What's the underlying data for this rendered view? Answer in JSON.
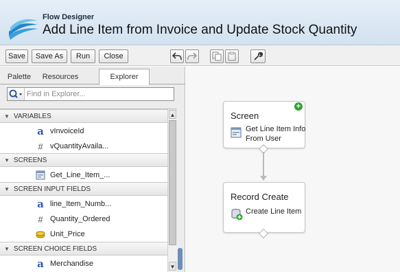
{
  "header": {
    "app_name": "Flow Designer",
    "flow_title": "Add Line Item from Invoice and Update Stock Quantity"
  },
  "toolbar": {
    "save": "Save",
    "save_as": "Save As",
    "run": "Run",
    "close": "Close",
    "icons": [
      "undo-icon",
      "redo-icon",
      "copy-icon",
      "paste-icon",
      "wrench-icon"
    ]
  },
  "sidebar": {
    "tabs": [
      {
        "label": "Palette",
        "active": false
      },
      {
        "label": "Resources",
        "active": false
      },
      {
        "label": "Explorer",
        "active": true
      }
    ],
    "search": {
      "placeholder": "Find in Explorer...",
      "value": ""
    },
    "sections": [
      {
        "title": "VARIABLES",
        "items": [
          {
            "icon": "text-a-icon",
            "label": "vInvoiceId"
          },
          {
            "icon": "number-hash-icon",
            "label": "vQuantityAvaila..."
          }
        ]
      },
      {
        "title": "SCREENS",
        "items": [
          {
            "icon": "screen-icon",
            "label": "Get_Line_Item_..."
          }
        ]
      },
      {
        "title": "SCREEN INPUT FIELDS",
        "items": [
          {
            "icon": "text-a-icon",
            "label": "line_Item_Numb..."
          },
          {
            "icon": "number-hash-icon",
            "label": "Quantity_Ordered"
          },
          {
            "icon": "currency-coins-icon",
            "label": "Unit_Price"
          }
        ]
      },
      {
        "title": "SCREEN CHOICE FIELDS",
        "items": [
          {
            "icon": "text-a-icon",
            "label": "Merchandise"
          }
        ]
      }
    ]
  },
  "canvas": {
    "nodes": [
      {
        "title": "Screen",
        "label": "Get Line Item Info From User",
        "icon": "screen-icon",
        "is_start": true
      },
      {
        "title": "Record Create",
        "label": "Create Line Item",
        "icon": "record-create-icon",
        "is_start": false
      }
    ]
  },
  "colors": {
    "header_bg": "#d9e6f2",
    "logo_blue": "#1f86c8",
    "start_green": "#2fa52f"
  }
}
